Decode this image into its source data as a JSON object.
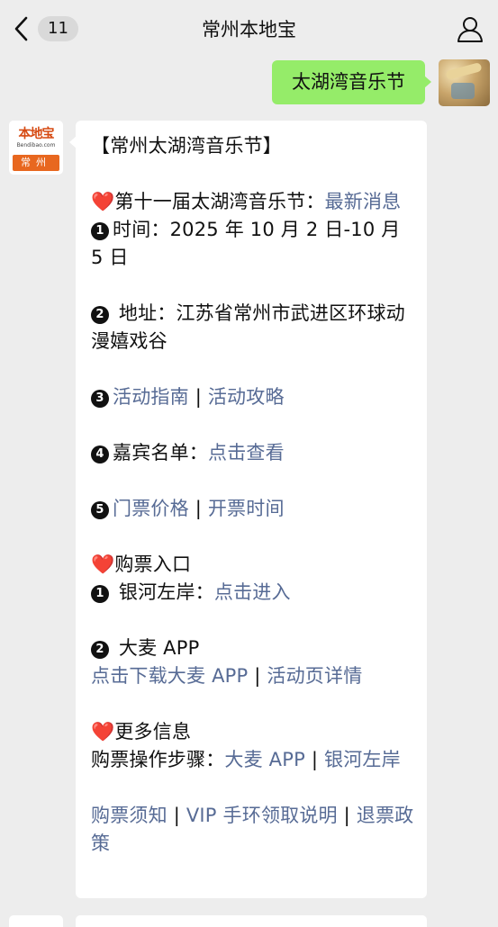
{
  "header": {
    "back_badge": "11",
    "title": "常州本地宝"
  },
  "outgoing": {
    "text": "太湖湾音乐节"
  },
  "avatar": {
    "logo_main": "本地宝",
    "logo_sub": "Bendibao.com",
    "logo_city": "常州"
  },
  "message": {
    "l1": "【常州太湖湾音乐节】",
    "l2_heart": "❤️",
    "l2_text": "第十一届太湖湾音乐节：",
    "l2_link": "最新消息",
    "l3_num": "1",
    "l3_text": "时间：2025 年 10 月 2 日-10 月 5 日",
    "l4_num": "2",
    "l4_text": " 地址：江苏省常州市武进区环球动漫嬉戏谷",
    "l5_num": "3",
    "l5_link1": "活动指南",
    "l5_sep": " | ",
    "l5_link2": "活动攻略",
    "l6_num": "4",
    "l6_text": "嘉宾名单：",
    "l6_link": "点击查看",
    "l7_num": "5",
    "l7_link1": "门票价格",
    "l7_sep": " | ",
    "l7_link2": "开票时间",
    "l8_heart": "❤️",
    "l8_text": "购票入口",
    "l9_num": "1",
    "l9_text": " 银河左岸：",
    "l9_link": "点击进入",
    "l10_num": "2",
    "l10_text": " 大麦 APP",
    "l11_link1": "点击下载大麦 APP",
    "l11_sep": " | ",
    "l11_link2": "活动页详情",
    "l12_heart": "❤️",
    "l12_text": "更多信息",
    "l13_text": "购票操作步骤：",
    "l13_link1": "大麦 APP",
    "l13_sep": " | ",
    "l13_link2": "银河左岸",
    "l14_link1": "购票须知",
    "l14_sep1": " | ",
    "l14_link2": "VIP 手环领取说明",
    "l14_sep2": " | ",
    "l14_link3": "退票政策"
  },
  "colors": {
    "link": "#576b95",
    "outgoing_bubble": "#95ec69",
    "background": "#ededed"
  }
}
